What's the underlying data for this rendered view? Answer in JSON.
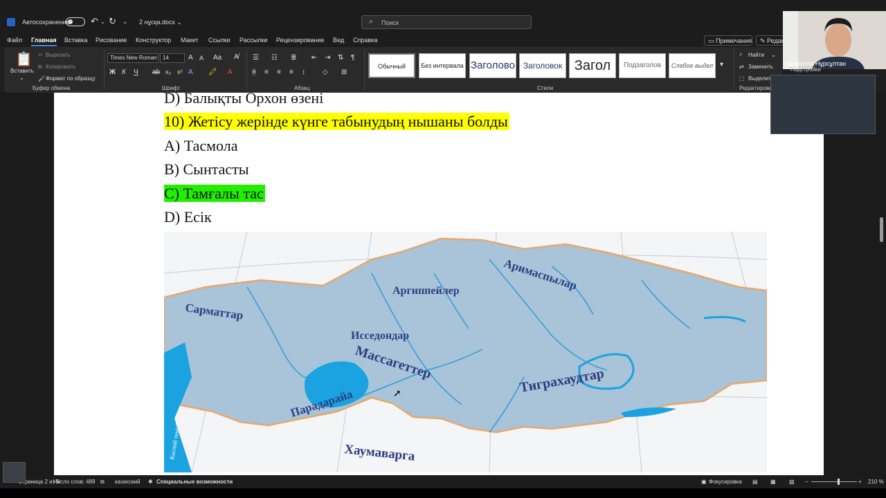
{
  "titlebar": {
    "autosave_label": "Автосохранение",
    "doc_name": "2 нұсқа.docx ⌄",
    "search_placeholder": "Поиск",
    "undo_icon": "undo-icon",
    "redo_icon": "redo-icon"
  },
  "menu": {
    "items": [
      "Файл",
      "Главная",
      "Вставка",
      "Рисование",
      "Конструктор",
      "Макет",
      "Ссылки",
      "Рассылки",
      "Рецензирование",
      "Вид",
      "Справка"
    ],
    "comments": "Примечания",
    "edit": "Редакт"
  },
  "ribbon": {
    "paste": "Вставить",
    "cut": "Вырезать",
    "copy": "Копировать",
    "format_painter": "Формат по образцу",
    "clipboard_group": "Буфер обмена",
    "font_name": "Times New Roman",
    "font_size": "14",
    "font_group": "Шрифт",
    "paragraph_group": "Абзац",
    "styles_group": "Стили",
    "styles": [
      "Обычный",
      "Без интервала",
      "Заголово",
      "Заголовок",
      "Загол",
      "Подзаголов",
      "Слабое выдел"
    ],
    "find": "Найти",
    "replace": "Заменить",
    "select": "Выделить",
    "editing_group": "Редактирова"
  },
  "document": {
    "lines": {
      "line_d_prev": "D) Балықты Орхон өзені",
      "question_10": "10) Жетісу жерінде күнге табынудың нышаны болды",
      "option_a": "A) Тасмола",
      "option_b": "B) Сынтасты",
      "option_c": "C) Тамғалы тас",
      "option_d": "D) Есік"
    },
    "map_labels": {
      "sarmat": "Сарматтар",
      "argip": "Аргиппейлер",
      "arimasp": "Аримаспылар",
      "issedon": "Исседондар",
      "massaget": "Массагеттер",
      "tigrak": "Тиграхаудтар",
      "paradaraya": "Парадарайа",
      "haumavarga": "Хаумаварга",
      "caspian": "Каспий теңізі"
    }
  },
  "video": {
    "name": "Хайролла Нұрсұлтан",
    "overlay": "Надстройки"
  },
  "statusbar": {
    "page": "Страница 2 из 5",
    "words": "Число слов: 489",
    "language": "казахский",
    "accessibility": "Специальные возможности",
    "focus": "Фокусировка",
    "zoom": "210 %"
  },
  "colors": {
    "highlight_yellow": "#ffff00",
    "highlight_green": "#22ee00",
    "map_land": "#a9c3d8",
    "map_water": "#1aa3e0",
    "accent": "#4a8ae8"
  }
}
